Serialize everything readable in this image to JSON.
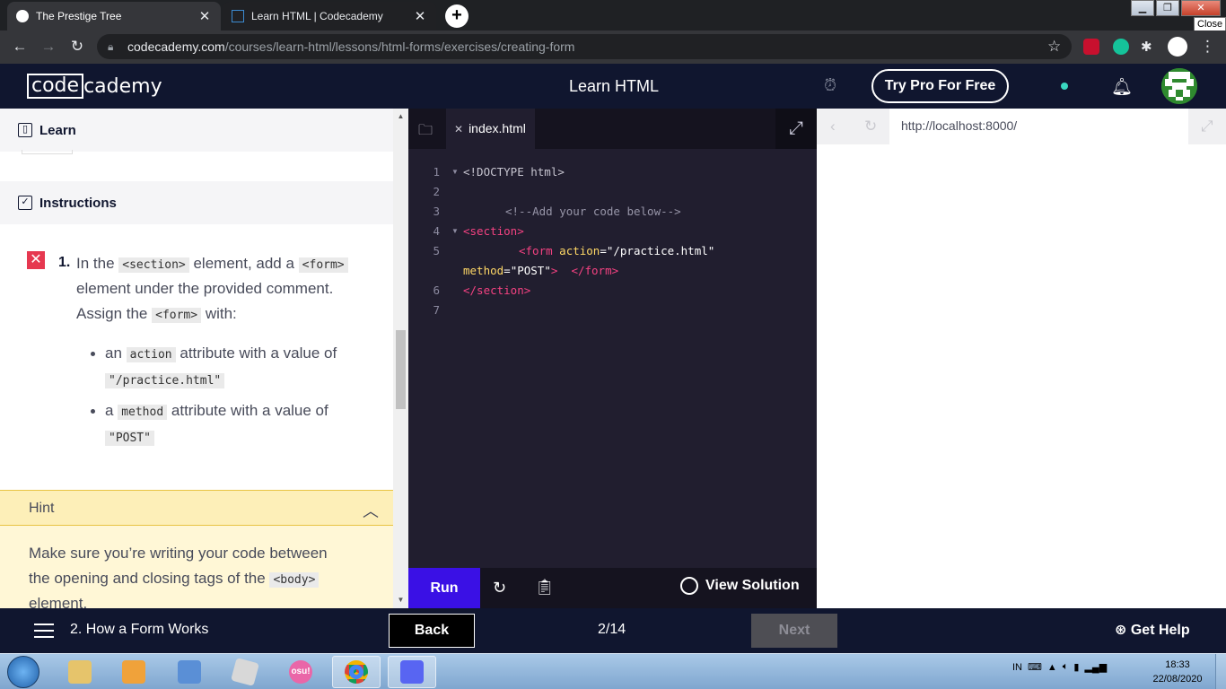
{
  "browser": {
    "tabs": [
      {
        "title": "The Prestige Tree",
        "close": "✕"
      },
      {
        "title": "Learn HTML | Codecademy",
        "close": "✕"
      }
    ],
    "new_tab": "+",
    "close_tooltip": "Close",
    "url_domain": "codecademy.com",
    "url_path": "/courses/learn-html/lessons/html-forms/exercises/creating-form"
  },
  "header": {
    "logo_box": "code",
    "logo_rest": "cademy",
    "course_title": "Learn HTML",
    "try_pro": "Try Pro For Free"
  },
  "left": {
    "learn_label": "Learn",
    "instructions_label": "Instructions",
    "task_number": "1.",
    "task": {
      "p1": "In the",
      "c1": "<section>",
      "p2": "element, add a",
      "c2": "<form>",
      "line2": "element under the provided comment.",
      "p3": "Assign the",
      "c3": "<form>",
      "p4": "with:"
    },
    "bullets": [
      {
        "pre": "an",
        "code": "action",
        "post": "attribute with a value of",
        "value": "\"/practice.html\""
      },
      {
        "pre": "a",
        "code": "method",
        "post": "attribute with a value of",
        "value": "\"POST\""
      }
    ],
    "hint_label": "Hint",
    "hint": {
      "line1": "Make sure you’re writing your code between",
      "p1": "the opening and closing tags of the",
      "c1": "<body>",
      "line3": "element."
    }
  },
  "editor": {
    "file_tab": "index.html",
    "line_numbers": [
      "1",
      "2",
      "3",
      "4",
      "5",
      "",
      "6",
      "7"
    ],
    "code": {
      "l1": "<!DOCTYPE html>",
      "l3": "<!--Add your code below-->",
      "l4": "<section>",
      "l5a_tag": "<form",
      "l5a_attr": "action",
      "l5a_eq": "=",
      "l5a_val": "\"/practice.html\"",
      "l5b_attr": "method",
      "l5b_eq": "=",
      "l5b_val": "\"POST\"",
      "l5b_tag1": ">",
      "l5b_tag2": "</form>",
      "l6": "</section>"
    },
    "run_label": "Run",
    "view_solution": "View Solution"
  },
  "preview": {
    "url": "http://localhost:8000/"
  },
  "footer": {
    "lesson": "2. How a Form Works",
    "back": "Back",
    "progress": "2/14",
    "next": "Next",
    "help": "Get Help"
  },
  "taskbar": {
    "lang": "IN",
    "time": "18:33",
    "date": "22/08/2020",
    "osu_label": "osu!"
  },
  "colors": {
    "cc_navy": "#10162f",
    "run_purple": "#3a10e5",
    "error_red": "#e63850",
    "hint_yellow": "#fdefb8",
    "code_tag": "#f54282",
    "code_attr": "#ffd866"
  }
}
